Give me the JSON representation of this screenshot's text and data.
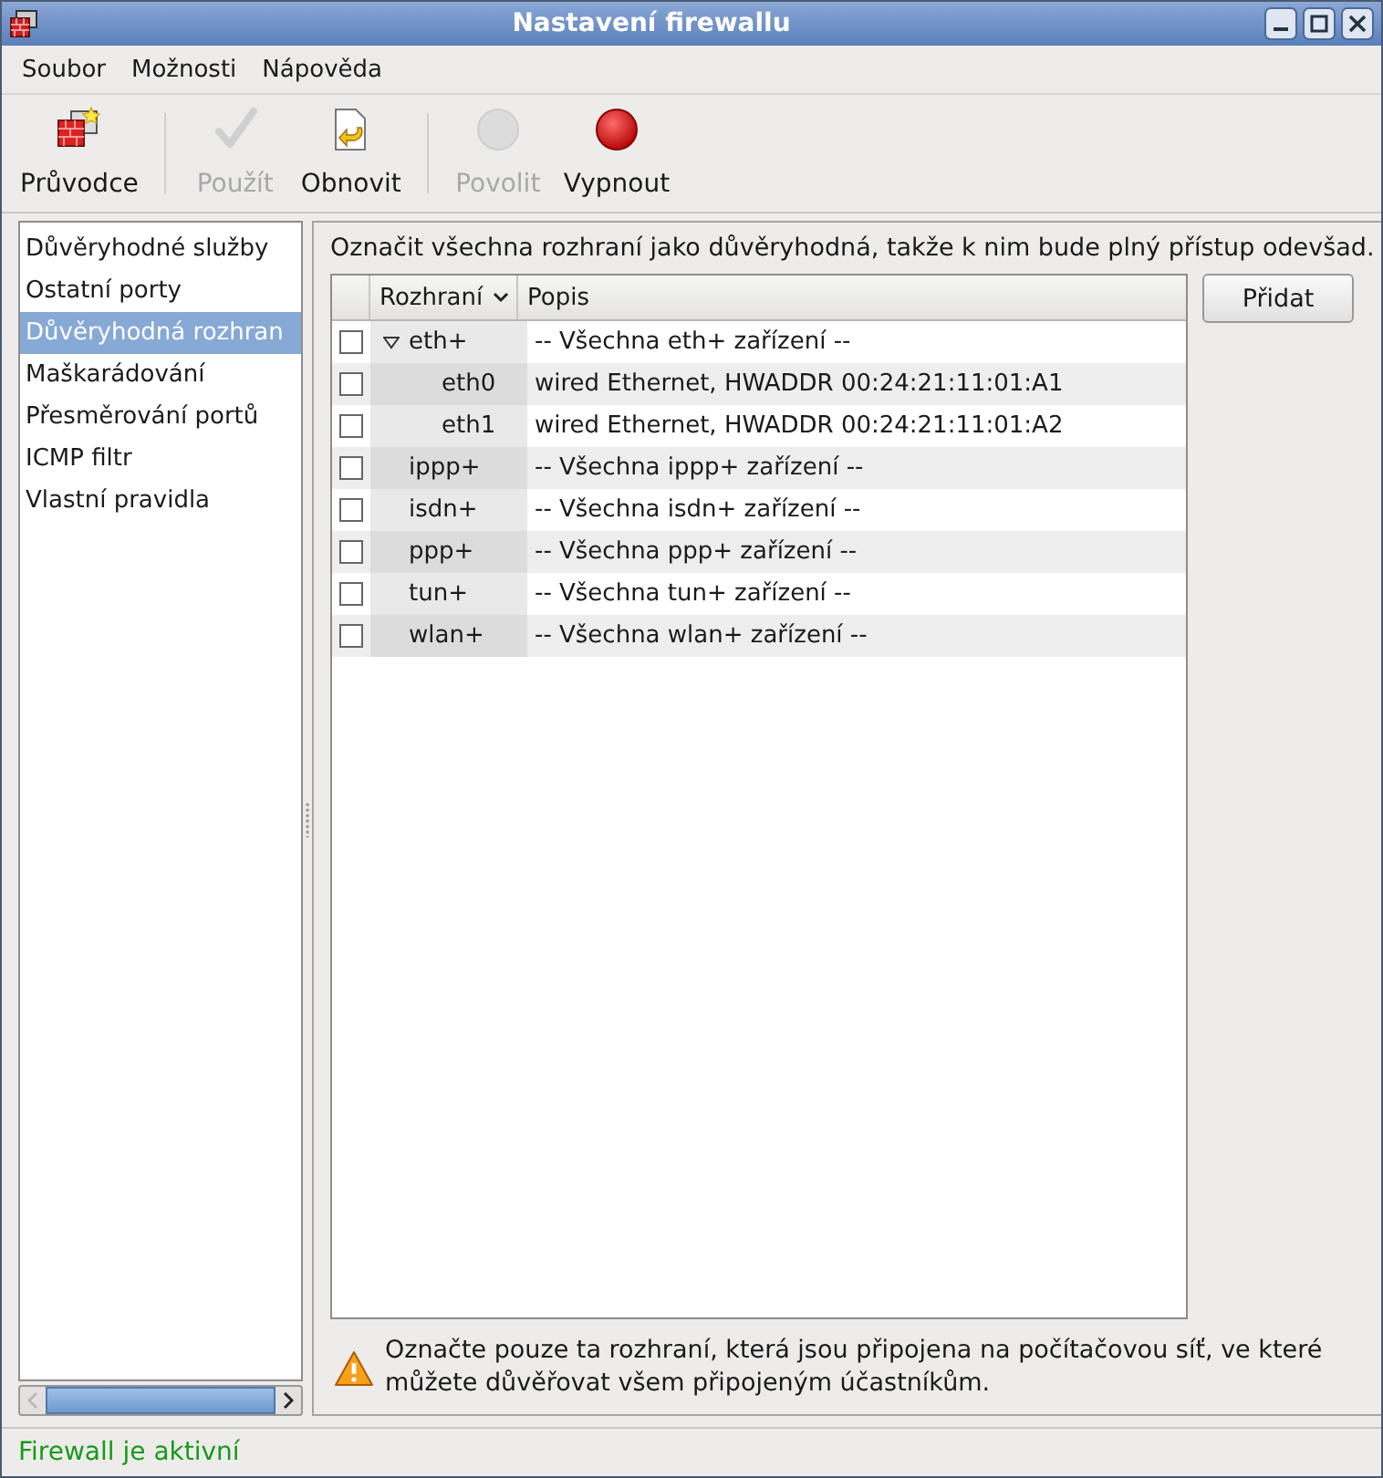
{
  "window": {
    "title": "Nastavení firewallu"
  },
  "menu": [
    "Soubor",
    "Možnosti",
    "Nápověda"
  ],
  "toolbar": [
    {
      "label": "Průvodce",
      "disabled": false
    },
    {
      "label": "Použít",
      "disabled": true
    },
    {
      "label": "Obnovit",
      "disabled": false
    },
    {
      "label": "Povolit",
      "disabled": true
    },
    {
      "label": "Vypnout",
      "disabled": false
    }
  ],
  "sidebar": {
    "items": [
      {
        "label": "Důvěryhodné služby",
        "selected": false
      },
      {
        "label": "Ostatní porty",
        "selected": false
      },
      {
        "label": "Důvěryhodná rozhran",
        "selected": true
      },
      {
        "label": "Maškarádování",
        "selected": false
      },
      {
        "label": "Přesměrování portů",
        "selected": false
      },
      {
        "label": "ICMP filtr",
        "selected": false
      },
      {
        "label": "Vlastní pravidla",
        "selected": false
      }
    ]
  },
  "panel": {
    "heading": "Označit všechna rozhraní jako důvěryhodná, takže k nim bude plný přístup odevšad.",
    "add_button": "Přidat",
    "note": "Označte pouze ta rozhraní, která jsou připojena na počítačovou síť, ve které můžete důvěřovat všem připojeným účastníkům."
  },
  "table": {
    "columns": [
      "Rozhraní",
      "Popis"
    ],
    "rows": [
      {
        "interface": "eth+",
        "description": "-- Všechna eth+ zařízení --",
        "checked": false,
        "expanded": true,
        "children": [
          {
            "interface": "eth0",
            "description": "wired Ethernet, HWADDR 00:24:21:11:01:A1",
            "checked": false
          },
          {
            "interface": "eth1",
            "description": "wired Ethernet, HWADDR 00:24:21:11:01:A2",
            "checked": false
          }
        ]
      },
      {
        "interface": "ippp+",
        "description": "-- Všechna ippp+ zařízení --",
        "checked": false
      },
      {
        "interface": "isdn+",
        "description": "-- Všechna isdn+ zařízení --",
        "checked": false
      },
      {
        "interface": "ppp+",
        "description": "-- Všechna ppp+ zařízení --",
        "checked": false
      },
      {
        "interface": "tun+",
        "description": "-- Všechna tun+ zařízení --",
        "checked": false
      },
      {
        "interface": "wlan+",
        "description": "-- Všechna wlan+ zařízení --",
        "checked": false
      }
    ]
  },
  "status_bar": "Firewall je aktivní"
}
